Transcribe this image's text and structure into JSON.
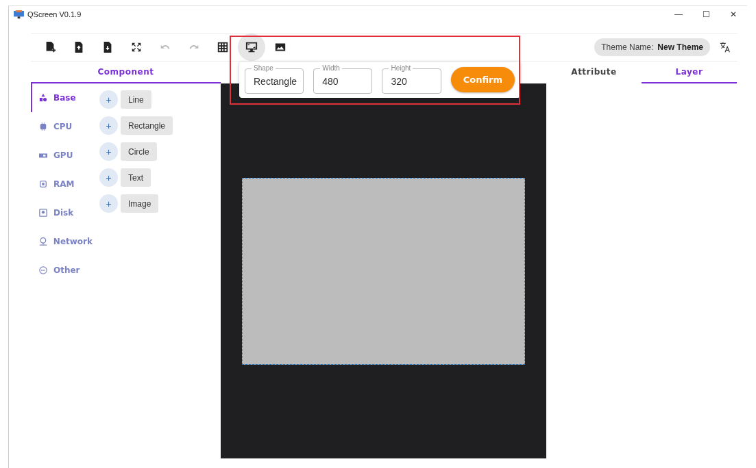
{
  "window": {
    "title": "QScreen V0.1.9"
  },
  "toolbar": [
    {
      "kind": "new-file",
      "selected": false,
      "disabled": false
    },
    {
      "kind": "upload-file",
      "selected": false,
      "disabled": false
    },
    {
      "kind": "download-file",
      "selected": false,
      "disabled": false
    },
    {
      "kind": "fullscreen",
      "selected": false,
      "disabled": false
    },
    {
      "kind": "undo",
      "selected": false,
      "disabled": true
    },
    {
      "kind": "redo",
      "selected": false,
      "disabled": true
    },
    {
      "kind": "grid",
      "selected": false,
      "disabled": false
    },
    {
      "kind": "screen",
      "selected": true,
      "disabled": false
    },
    {
      "kind": "image",
      "selected": false,
      "disabled": false
    }
  ],
  "theme": {
    "label": "Theme Name:",
    "value": "New Theme"
  },
  "left_tabs": [
    {
      "label": "Component",
      "selected": true
    }
  ],
  "right_tabs": [
    {
      "label": "Attribute",
      "selected": false
    },
    {
      "label": "Layer",
      "selected": true
    }
  ],
  "categories": [
    {
      "kind": "base",
      "label": "Base",
      "selected": true
    },
    {
      "kind": "cpu",
      "label": "CPU",
      "selected": false
    },
    {
      "kind": "gpu",
      "label": "GPU",
      "selected": false
    },
    {
      "kind": "ram",
      "label": "RAM",
      "selected": false
    },
    {
      "kind": "disk",
      "label": "Disk",
      "selected": false
    },
    {
      "kind": "network",
      "label": "Network",
      "selected": false
    },
    {
      "kind": "other",
      "label": "Other",
      "selected": false
    }
  ],
  "components": [
    {
      "add": "+",
      "label": "Line"
    },
    {
      "add": "+",
      "label": "Rectangle"
    },
    {
      "add": "+",
      "label": "Circle"
    },
    {
      "add": "+",
      "label": "Text"
    },
    {
      "add": "+",
      "label": "Image"
    }
  ],
  "screen_popup": {
    "fields": [
      {
        "label": "Shape",
        "value": "Rectangle"
      },
      {
        "label": "Width",
        "value": "480"
      },
      {
        "label": "Height",
        "value": "320"
      }
    ],
    "confirm": "Confirm"
  },
  "window_controls": [
    "—",
    "☐",
    "✕"
  ]
}
